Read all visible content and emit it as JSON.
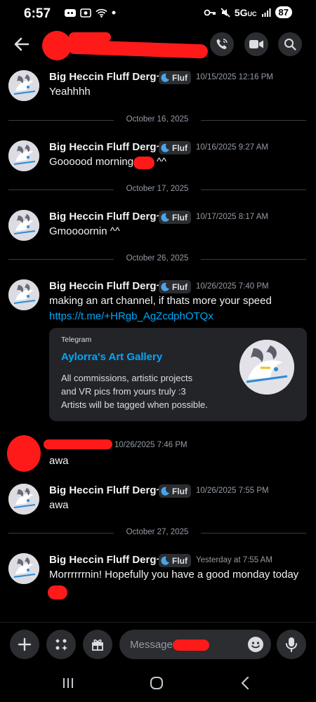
{
  "status_bar": {
    "time": "6:57",
    "network": "5G",
    "network_sub": "UC",
    "battery": "87"
  },
  "header": {
    "back_icon": "arrow-left-icon",
    "call_icon": "phone-icon",
    "video_icon": "video-icon",
    "search_icon": "search-icon"
  },
  "messages": [
    {
      "username": "Big Heccin Fluff Derg~",
      "tag": "Fluf",
      "timestamp": "10/15/2025 12:16 PM",
      "text": "Yeahhhh"
    },
    {
      "username": "Big Heccin Fluff Derg~",
      "tag": "Fluf",
      "timestamp": "10/16/2025 9:27 AM",
      "text": "Goooood morning",
      "text_suffix": "^^"
    },
    {
      "username": "Big Heccin Fluff Derg~",
      "tag": "Fluf",
      "timestamp": "10/17/2025 8:17 AM",
      "text": "Gmoooornin ^^"
    },
    {
      "username": "Big Heccin Fluff Derg~",
      "tag": "Fluf",
      "timestamp": "10/26/2025 7:40 PM",
      "text": "making an art channel, if thats more your speed",
      "link": "https://t.me/+HRgb_AgZcdphOTQx",
      "embed": {
        "provider": "Telegram",
        "title": "Aylorra's Art Gallery",
        "description": "All commissions, artistic projects\nand VR pics from yours truly :3\nArtists will be tagged when possible."
      }
    },
    {
      "username": "",
      "timestamp": "10/26/2025 7:46 PM",
      "text": "awa"
    },
    {
      "username": "Big Heccin Fluff Derg~",
      "tag": "Fluf",
      "timestamp": "10/26/2025 7:55 PM",
      "text": "awa"
    },
    {
      "username": "Big Heccin Fluff Derg~",
      "tag": "Fluf",
      "timestamp": "Yesterday at 7:55 AM",
      "text": "Morrrrrrnin! Hopefully you have a good monday today"
    }
  ],
  "dividers": [
    "October 16, 2025",
    "October 17, 2025",
    "October 26, 2025",
    "October 27, 2025"
  ],
  "composer": {
    "placeholder": "Message",
    "plus_icon": "plus-icon",
    "apps_icon": "apps-icon",
    "gift_icon": "gift-icon",
    "emoji_icon": "emoji-icon",
    "mic_icon": "microphone-icon"
  },
  "colors": {
    "background": "#000000",
    "accent_link": "#00a8fc",
    "redaction": "#ff1a1a",
    "panel": "#2b2d31"
  }
}
